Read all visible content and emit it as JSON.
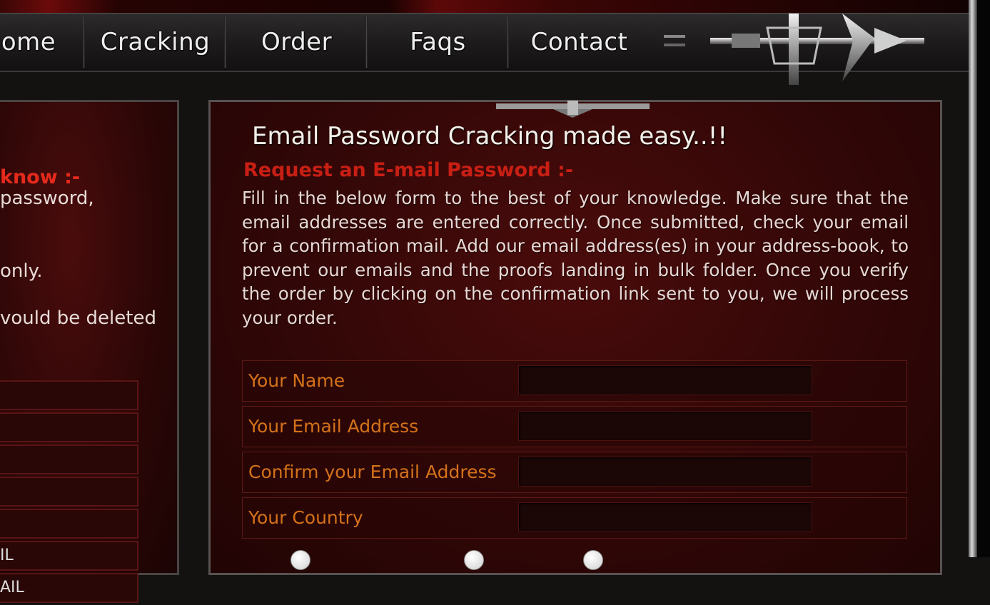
{
  "nav": {
    "items": [
      "ome",
      "Cracking",
      "Order",
      "Faqs",
      "Contact"
    ]
  },
  "left_panel": {
    "title": "know :-",
    "lines": [
      "password,",
      "only.",
      "vould be deleted"
    ],
    "rows": [
      "",
      "",
      "",
      "",
      "",
      "IL",
      "AIL"
    ]
  },
  "main": {
    "title": "Email Password Cracking made easy..!!",
    "section_title": "Request an E-mail Password :-",
    "intro": "Fill in the below form to the best of your knowledge. Make sure that the email addresses are entered correctly. Once submitted, check your email for a confirmation mail. Add our email address(es) in your address-book, to prevent our emails and the proofs landing in bulk folder. Once you verify the order by clicking on the confirmation link sent to you, we will process your order.",
    "form": {
      "fields": [
        {
          "label": "Your Name",
          "value": ""
        },
        {
          "label": "Your Email Address",
          "value": ""
        },
        {
          "label": "Confirm your Email Address",
          "value": ""
        },
        {
          "label": "Your Country",
          "value": ""
        }
      ]
    }
  },
  "colors": {
    "nav_text": "#eeeeee",
    "heading_red": "#c81f14",
    "label_orange": "#d4721a",
    "body_text": "#e6d8d4",
    "panel_bg": "#320707"
  }
}
